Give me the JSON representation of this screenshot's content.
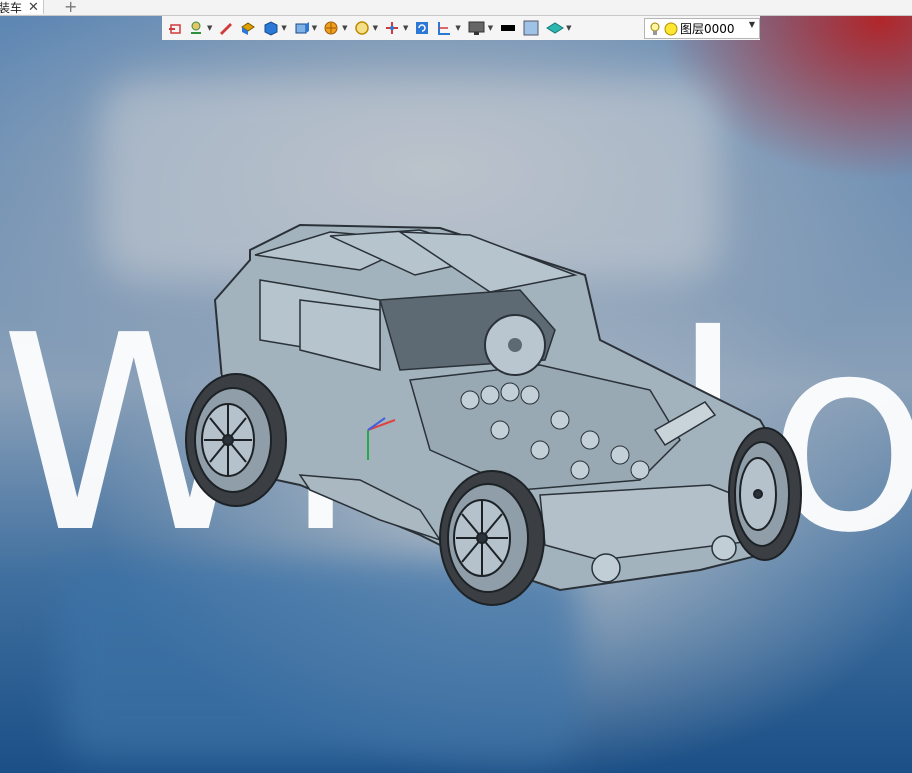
{
  "tab": {
    "label": "装车",
    "close_glyph": "✕",
    "add_glyph": "+"
  },
  "toolbar": {
    "tools": [
      {
        "name": "sketch-plane-icon",
        "color": "#d23a3a"
      },
      {
        "name": "hole-feature-icon",
        "color": "#2f8f3a"
      },
      {
        "name": "pencil-icon",
        "color": "#d23a3a"
      },
      {
        "name": "extrude-icon",
        "color": "#e0a100"
      },
      {
        "name": "solid-cube-icon",
        "color": "#2b78d6"
      },
      {
        "name": "view-cube-icon",
        "color": "#2b78d6"
      },
      {
        "name": "render-mode-icon",
        "color": "#e08a00"
      },
      {
        "name": "zoom-icon",
        "color": "#e0a100"
      },
      {
        "name": "axis-icon",
        "color": "#d23a3a"
      },
      {
        "name": "rotate-icon",
        "color": "#2b78d6"
      },
      {
        "name": "section-icon",
        "color": "#2b78d6"
      },
      {
        "name": "display-icon",
        "color": "#555555"
      },
      {
        "name": "color-black-swatch",
        "color": "#000000"
      },
      {
        "name": "color-blue-swatch",
        "color": "#9fc3e6"
      },
      {
        "name": "style-icon",
        "color": "#2bb7b0"
      }
    ],
    "layer_value": "图层0000"
  },
  "watermark_text": "Window",
  "colors": {
    "car_body": "#aab8c2",
    "car_dark": "#2a3138",
    "tire": "#3b3f44"
  }
}
